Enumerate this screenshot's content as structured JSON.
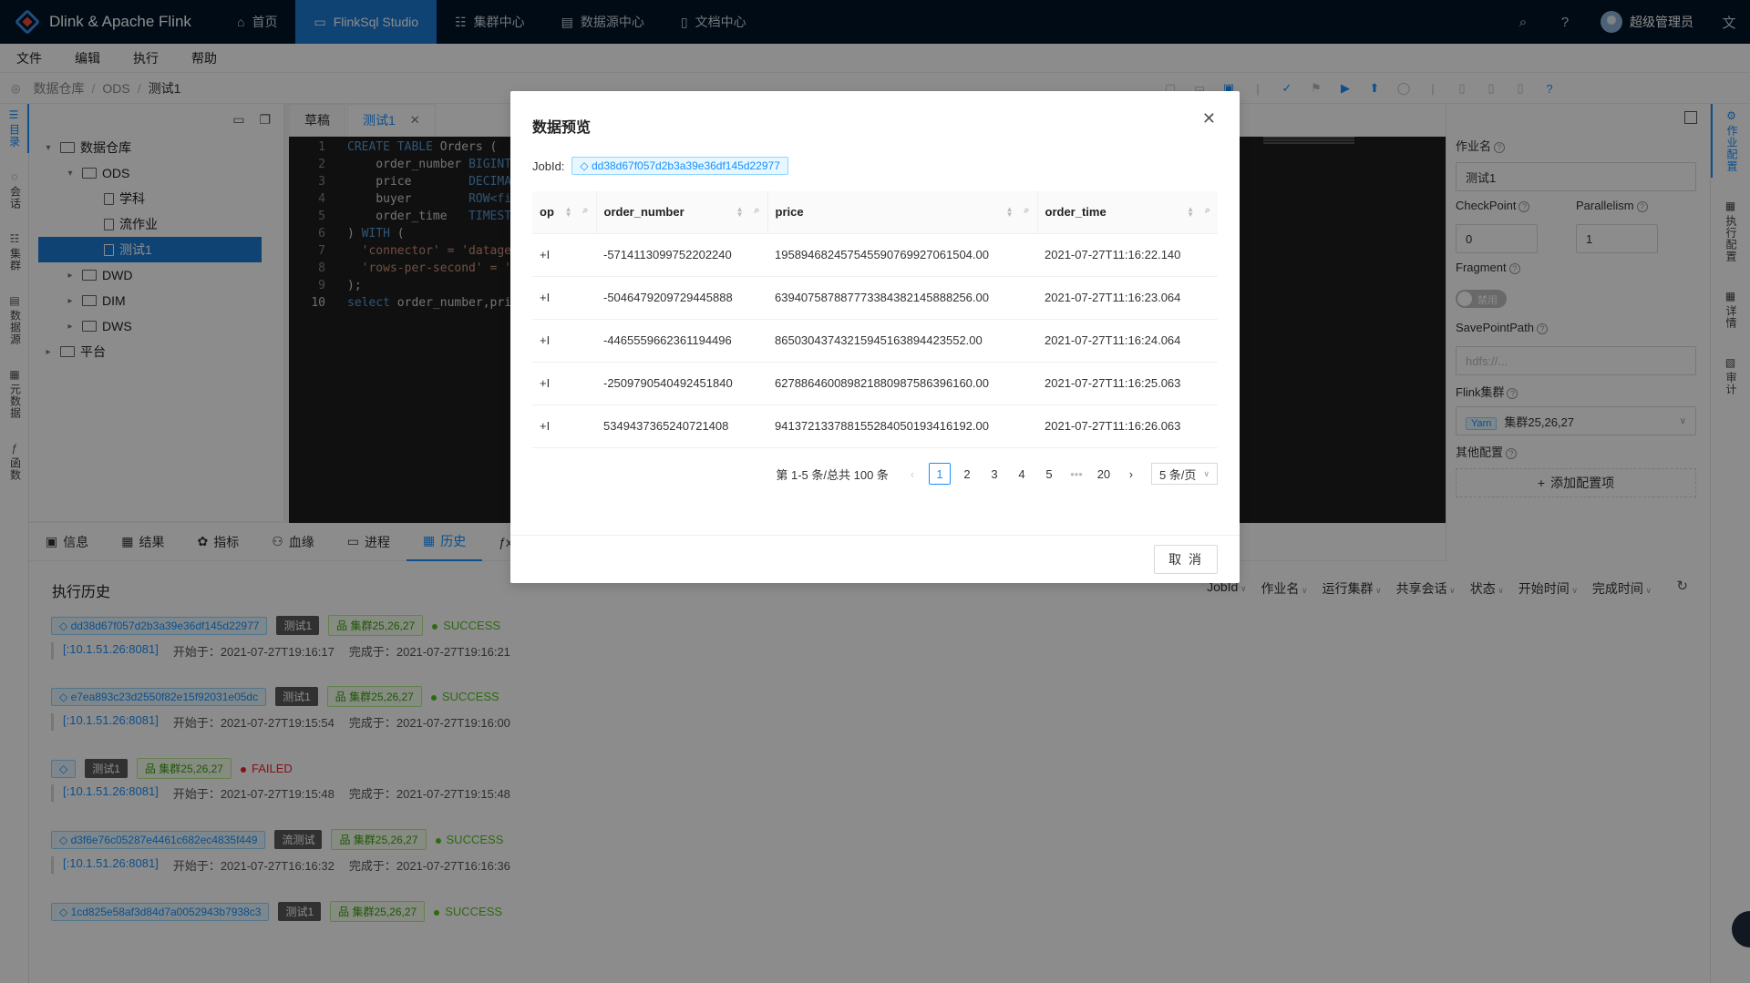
{
  "nav": {
    "brand": "Dlink & Apache Flink",
    "items": [
      {
        "label": "首页",
        "icon": "home-icon",
        "active": false
      },
      {
        "label": "FlinkSql Studio",
        "icon": "monitor-icon",
        "active": true
      },
      {
        "label": "集群中心",
        "icon": "cluster-icon",
        "active": false
      },
      {
        "label": "数据源中心",
        "icon": "database-icon",
        "active": false
      },
      {
        "label": "文档中心",
        "icon": "document-icon",
        "active": false
      }
    ],
    "user": "超级管理员"
  },
  "menu": [
    "文件",
    "编辑",
    "执行",
    "帮助"
  ],
  "breadcrumb": [
    "数据仓库",
    "ODS",
    "测试1"
  ],
  "left_tabs": [
    "目录",
    "会话",
    "集群",
    "数据源",
    "元数据",
    "函数"
  ],
  "tree": {
    "root": "数据仓库",
    "ods": "ODS",
    "files": [
      "学科",
      "流作业",
      "测试1"
    ],
    "dwd": "DWD",
    "dim": "DIM",
    "dws": "DWS",
    "platform": "平台"
  },
  "editor_tabs": [
    {
      "label": "草稿"
    },
    {
      "label": "测试1"
    }
  ],
  "code": {
    "line_numbers": [
      "1",
      "2",
      "3",
      "4",
      "5",
      "6",
      "7",
      "8",
      "9",
      "10"
    ],
    "l1_kw": "CREATE TABLE",
    "l1_rest": " Orders (",
    "l2_name": "    order_number ",
    "l2_type": "BIGINT",
    "l3_name": "    price        ",
    "l3_type": "DECIMA",
    "l4_name": "    buyer        ",
    "l4_type": "ROW<fi",
    "l5_name": "    order_time   ",
    "l5_type": "TIMEST",
    "l6_rest": ") ",
    "l6_kw": "WITH",
    "l6_tail": " (",
    "l7_str": "  'connector' = 'datage",
    "l8_str": "  'rows-per-second' = '",
    "l9": ");",
    "l10_kw": "select",
    "l10_rest": " order_number,pri"
  },
  "config": {
    "job_name_label": "作业名",
    "job_name_value": "测试1",
    "checkpoint_label": "CheckPoint",
    "checkpoint_value": "0",
    "parallelism_label": "Parallelism",
    "parallelism_value": "1",
    "fragment_label": "Fragment",
    "fragment_toggle": "禁用",
    "savepoint_label": "SavePointPath",
    "savepoint_placeholder": "hdfs://...",
    "cluster_label": "Flink集群",
    "cluster_tag": "Yarn",
    "cluster_value": "集群25,26,27",
    "other_label": "其他配置",
    "add_config": "添加配置项"
  },
  "right_tabs": [
    "作业配置",
    "执行配置",
    "详情",
    "审计"
  ],
  "bottom_tabs": [
    {
      "label": "信息",
      "icon": "info-icon"
    },
    {
      "label": "结果",
      "icon": "table-icon"
    },
    {
      "label": "指标",
      "icon": "metrics-icon"
    },
    {
      "label": "血缘",
      "icon": "lineage-icon"
    },
    {
      "label": "进程",
      "icon": "process-icon"
    },
    {
      "label": "历史",
      "icon": "calendar-icon"
    }
  ],
  "history": {
    "title": "执行历史",
    "filters": [
      "JobId",
      "作业名",
      "运行集群",
      "共享会话",
      "状态",
      "开始时间",
      "完成时间"
    ],
    "items": [
      {
        "jobid": "dd38d67f057d2b3a39e36df145d22977",
        "job": "测试1",
        "cluster": "集群25,26,27",
        "status": "SUCCESS",
        "addr": "[:10.1.51.26:8081]",
        "start": "开始于：2021-07-27T19:16:17",
        "end": "完成于：2021-07-27T19:16:21"
      },
      {
        "jobid": "e7ea893c23d2550f82e15f92031e05dc",
        "job": "测试1",
        "cluster": "集群25,26,27",
        "status": "SUCCESS",
        "addr": "[:10.1.51.26:8081]",
        "start": "开始于：2021-07-27T19:15:54",
        "end": "完成于：2021-07-27T19:16:00"
      },
      {
        "jobid": "",
        "job": "测试1",
        "cluster": "集群25,26,27",
        "status": "FAILED",
        "addr": "[:10.1.51.26:8081]",
        "start": "开始于：2021-07-27T19:15:48",
        "end": "完成于：2021-07-27T19:15:48"
      },
      {
        "jobid": "d3f6e76c05287e4461c682ec4835f449",
        "job": "流测试",
        "cluster": "集群25,26,27",
        "status": "SUCCESS",
        "addr": "[:10.1.51.26:8081]",
        "start": "开始于：2021-07-27T16:16:32",
        "end": "完成于：2021-07-27T16:16:36"
      },
      {
        "jobid": "1cd825e58af3d84d7a0052943b7938c3",
        "job": "测试1",
        "cluster": "集群25,26,27",
        "status": "SUCCESS"
      }
    ]
  },
  "modal": {
    "title": "数据预览",
    "jobid_label": "JobId:",
    "jobid": "dd38d67f057d2b3a39e36df145d22977",
    "columns": [
      "op",
      "order_number",
      "price",
      "order_time"
    ],
    "rows": [
      [
        "+I",
        "-5714113099752202240",
        "19589468245754559076992706150​4.00",
        "2021-07-27T11:16:22.140"
      ],
      [
        "+I",
        "-5046479209729445888",
        "63940758788777338438214588825​6.00",
        "2021-07-27T11:16:23.064"
      ],
      [
        "+I",
        "-4465559662361194496",
        "86503043743215945163894423552.00",
        "2021-07-27T11:16:24.064"
      ],
      [
        "+I",
        "-2509790540492451840",
        "62788646008982188098758639616​0.00",
        "2021-07-27T11:16:25.063"
      ],
      [
        "+I",
        "5349437365240721408",
        "94137213378815528405019341619​2.00",
        "2021-07-27T11:16:26.063"
      ]
    ],
    "pagination": {
      "total_text": "第 1-5 条/总共 100 条",
      "pages": [
        "1",
        "2",
        "3",
        "4",
        "5",
        "•••",
        "20"
      ],
      "page_size": "5 条/页"
    },
    "cancel": "取 消"
  }
}
